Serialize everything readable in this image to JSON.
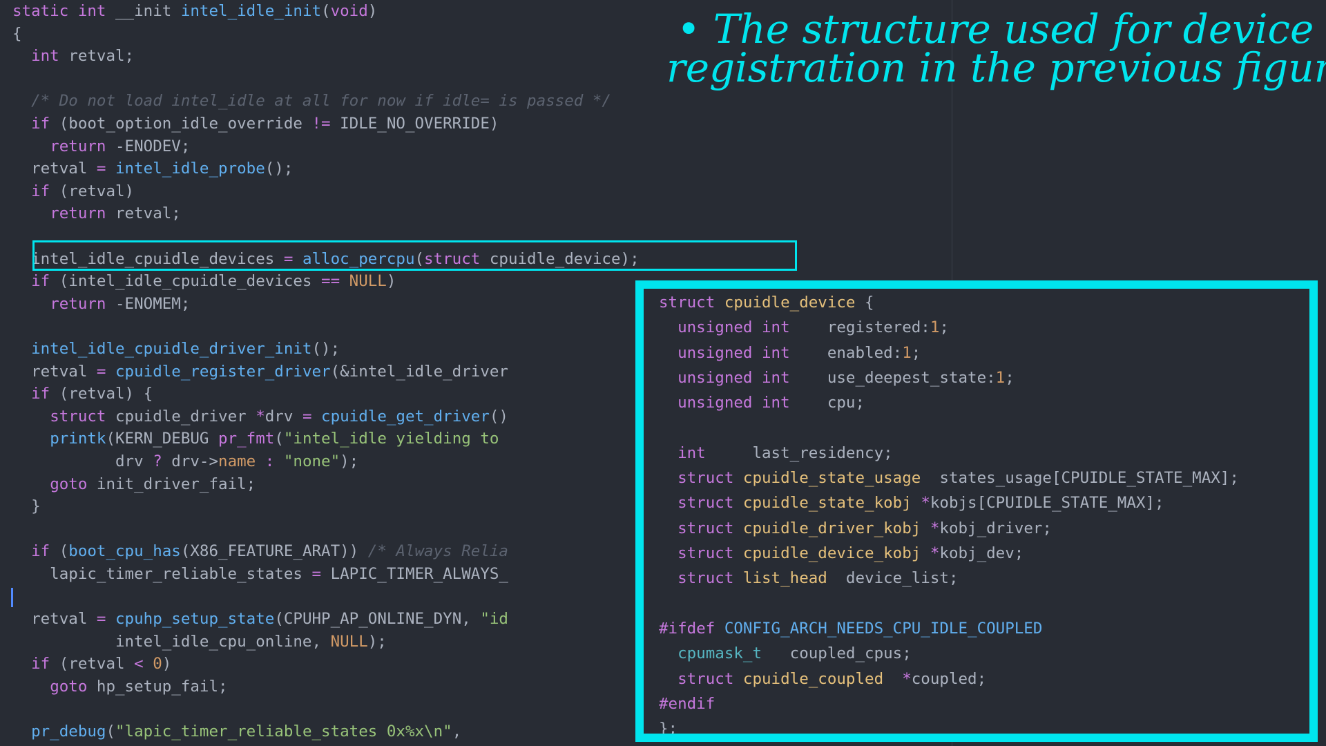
{
  "colors": {
    "background": "#282c34",
    "annotation": "#00e5ee",
    "keyword": "#c678dd",
    "function": "#61afef",
    "type": "#e5c07b",
    "number": "#d19a66",
    "string": "#98c379",
    "comment": "#5c6370"
  },
  "code_lines": [
    [
      {
        "t": "static int ",
        "c": "kw"
      },
      {
        "t": "__init ",
        "c": ""
      },
      {
        "t": "intel_idle_init",
        "c": "fn"
      },
      {
        "t": "(",
        "c": ""
      },
      {
        "t": "void",
        "c": "kw"
      },
      {
        "t": ")",
        "c": ""
      }
    ],
    [
      {
        "t": "{",
        "c": ""
      }
    ],
    [
      {
        "t": "  ",
        "c": ""
      },
      {
        "t": "int",
        "c": "kw"
      },
      {
        "t": " retval;",
        "c": ""
      }
    ],
    [],
    [
      {
        "t": "  /* Do not load intel_idle at all for now if idle= is passed */",
        "c": "cmt"
      }
    ],
    [
      {
        "t": "  ",
        "c": ""
      },
      {
        "t": "if",
        "c": "kw"
      },
      {
        "t": " (boot_option_idle_override ",
        "c": ""
      },
      {
        "t": "!=",
        "c": "op"
      },
      {
        "t": " IDLE_NO_OVERRIDE)",
        "c": ""
      }
    ],
    [
      {
        "t": "    ",
        "c": ""
      },
      {
        "t": "return",
        "c": "kw"
      },
      {
        "t": " -ENODEV;",
        "c": ""
      }
    ],
    [
      {
        "t": "  retval ",
        "c": ""
      },
      {
        "t": "=",
        "c": "op"
      },
      {
        "t": " ",
        "c": ""
      },
      {
        "t": "intel_idle_probe",
        "c": "fn"
      },
      {
        "t": "();",
        "c": ""
      }
    ],
    [
      {
        "t": "  ",
        "c": ""
      },
      {
        "t": "if",
        "c": "kw"
      },
      {
        "t": " (retval)",
        "c": ""
      }
    ],
    [
      {
        "t": "    ",
        "c": ""
      },
      {
        "t": "return",
        "c": "kw"
      },
      {
        "t": " retval;",
        "c": ""
      }
    ],
    [],
    [
      {
        "t": "  intel_idle_cpuidle_devices ",
        "c": ""
      },
      {
        "t": "=",
        "c": "op"
      },
      {
        "t": " ",
        "c": ""
      },
      {
        "t": "alloc_percpu",
        "c": "fn"
      },
      {
        "t": "(",
        "c": ""
      },
      {
        "t": "struct",
        "c": "kw"
      },
      {
        "t": " cpuidle_device);",
        "c": ""
      }
    ],
    [
      {
        "t": "  ",
        "c": ""
      },
      {
        "t": "if",
        "c": "kw"
      },
      {
        "t": " (intel_idle_cpuidle_devices ",
        "c": ""
      },
      {
        "t": "==",
        "c": "op"
      },
      {
        "t": " ",
        "c": ""
      },
      {
        "t": "NULL",
        "c": "num"
      },
      {
        "t": ")",
        "c": ""
      }
    ],
    [
      {
        "t": "    ",
        "c": ""
      },
      {
        "t": "return",
        "c": "kw"
      },
      {
        "t": " -ENOMEM;",
        "c": ""
      }
    ],
    [],
    [
      {
        "t": "  ",
        "c": ""
      },
      {
        "t": "intel_idle_cpuidle_driver_init",
        "c": "fn"
      },
      {
        "t": "();",
        "c": ""
      }
    ],
    [
      {
        "t": "  retval ",
        "c": ""
      },
      {
        "t": "=",
        "c": "op"
      },
      {
        "t": " ",
        "c": ""
      },
      {
        "t": "cpuidle_register_driver",
        "c": "fn"
      },
      {
        "t": "(&intel_idle_driver",
        "c": ""
      }
    ],
    [
      {
        "t": "  ",
        "c": ""
      },
      {
        "t": "if",
        "c": "kw"
      },
      {
        "t": " (retval) {",
        "c": ""
      }
    ],
    [
      {
        "t": "    ",
        "c": ""
      },
      {
        "t": "struct",
        "c": "kw"
      },
      {
        "t": " cpuidle_driver ",
        "c": ""
      },
      {
        "t": "*",
        "c": "op"
      },
      {
        "t": "drv ",
        "c": ""
      },
      {
        "t": "=",
        "c": "op"
      },
      {
        "t": " ",
        "c": ""
      },
      {
        "t": "cpuidle_get_driver",
        "c": "fn"
      },
      {
        "t": "()",
        "c": ""
      }
    ],
    [
      {
        "t": "    ",
        "c": ""
      },
      {
        "t": "printk",
        "c": "fn"
      },
      {
        "t": "(KERN_DEBUG ",
        "c": ""
      },
      {
        "t": "pr_fmt",
        "c": "kw"
      },
      {
        "t": "(",
        "c": ""
      },
      {
        "t": "\"intel_idle yielding to",
        "c": "str"
      }
    ],
    [
      {
        "t": "           drv ",
        "c": ""
      },
      {
        "t": "?",
        "c": "op"
      },
      {
        "t": " drv->",
        "c": ""
      },
      {
        "t": "name",
        "c": "num"
      },
      {
        "t": " ",
        "c": ""
      },
      {
        "t": ":",
        "c": "op"
      },
      {
        "t": " ",
        "c": ""
      },
      {
        "t": "\"none\"",
        "c": "str"
      },
      {
        "t": ");",
        "c": ""
      }
    ],
    [
      {
        "t": "    ",
        "c": ""
      },
      {
        "t": "goto",
        "c": "kw"
      },
      {
        "t": " init_driver_fail;",
        "c": ""
      }
    ],
    [
      {
        "t": "  }",
        "c": ""
      }
    ],
    [],
    [
      {
        "t": "  ",
        "c": ""
      },
      {
        "t": "if",
        "c": "kw"
      },
      {
        "t": " (",
        "c": ""
      },
      {
        "t": "boot_cpu_has",
        "c": "fn"
      },
      {
        "t": "(X86_FEATURE_ARAT)) ",
        "c": ""
      },
      {
        "t": "/* Always Relia",
        "c": "cmt"
      }
    ],
    [
      {
        "t": "    lapic_timer_reliable_states ",
        "c": ""
      },
      {
        "t": "=",
        "c": "op"
      },
      {
        "t": " LAPIC_TIMER_ALWAYS_",
        "c": ""
      }
    ],
    [],
    [
      {
        "t": "  retval ",
        "c": ""
      },
      {
        "t": "=",
        "c": "op"
      },
      {
        "t": " ",
        "c": ""
      },
      {
        "t": "cpuhp_setup_state",
        "c": "fn"
      },
      {
        "t": "(CPUHP_AP_ONLINE_DYN, ",
        "c": ""
      },
      {
        "t": "\"id",
        "c": "str"
      }
    ],
    [
      {
        "t": "           intel_idle_cpu_online, ",
        "c": ""
      },
      {
        "t": "NULL",
        "c": "num"
      },
      {
        "t": ");",
        "c": ""
      }
    ],
    [
      {
        "t": "  ",
        "c": ""
      },
      {
        "t": "if",
        "c": "kw"
      },
      {
        "t": " (retval ",
        "c": ""
      },
      {
        "t": "<",
        "c": "op"
      },
      {
        "t": " ",
        "c": ""
      },
      {
        "t": "0",
        "c": "num"
      },
      {
        "t": ")",
        "c": ""
      }
    ],
    [
      {
        "t": "    ",
        "c": ""
      },
      {
        "t": "goto",
        "c": "kw"
      },
      {
        "t": " hp_setup_fail;",
        "c": ""
      }
    ],
    [],
    [
      {
        "t": "  ",
        "c": ""
      },
      {
        "t": "pr_debug",
        "c": "fn"
      },
      {
        "t": "(",
        "c": ""
      },
      {
        "t": "\"lapic_timer_reliable_states 0x%x\\n\"",
        "c": "str"
      },
      {
        "t": ",",
        "c": ""
      }
    ]
  ],
  "struct_lines": [
    [
      {
        "t": "struct ",
        "c": "kw"
      },
      {
        "t": "cpuidle_device",
        "c": "ty"
      },
      {
        "t": " {",
        "c": ""
      }
    ],
    [
      {
        "t": "  ",
        "c": ""
      },
      {
        "t": "unsigned int",
        "c": "kw"
      },
      {
        "t": "    registered:",
        "c": ""
      },
      {
        "t": "1",
        "c": "num"
      },
      {
        "t": ";",
        "c": ""
      }
    ],
    [
      {
        "t": "  ",
        "c": ""
      },
      {
        "t": "unsigned int",
        "c": "kw"
      },
      {
        "t": "    enabled:",
        "c": ""
      },
      {
        "t": "1",
        "c": "num"
      },
      {
        "t": ";",
        "c": ""
      }
    ],
    [
      {
        "t": "  ",
        "c": ""
      },
      {
        "t": "unsigned int",
        "c": "kw"
      },
      {
        "t": "    use_deepest_state:",
        "c": ""
      },
      {
        "t": "1",
        "c": "num"
      },
      {
        "t": ";",
        "c": ""
      }
    ],
    [
      {
        "t": "  ",
        "c": ""
      },
      {
        "t": "unsigned int",
        "c": "kw"
      },
      {
        "t": "    cpu;",
        "c": ""
      }
    ],
    [],
    [
      {
        "t": "  ",
        "c": ""
      },
      {
        "t": "int",
        "c": "kw"
      },
      {
        "t": "     last_residency;",
        "c": ""
      }
    ],
    [
      {
        "t": "  ",
        "c": ""
      },
      {
        "t": "struct",
        "c": "kw"
      },
      {
        "t": " ",
        "c": ""
      },
      {
        "t": "cpuidle_state_usage",
        "c": "ty"
      },
      {
        "t": "  states_usage[CPUIDLE_STATE_MAX];",
        "c": ""
      }
    ],
    [
      {
        "t": "  ",
        "c": ""
      },
      {
        "t": "struct",
        "c": "kw"
      },
      {
        "t": " ",
        "c": ""
      },
      {
        "t": "cpuidle_state_kobj",
        "c": "ty"
      },
      {
        "t": " ",
        "c": ""
      },
      {
        "t": "*",
        "c": "op"
      },
      {
        "t": "kobjs[CPUIDLE_STATE_MAX];",
        "c": ""
      }
    ],
    [
      {
        "t": "  ",
        "c": ""
      },
      {
        "t": "struct",
        "c": "kw"
      },
      {
        "t": " ",
        "c": ""
      },
      {
        "t": "cpuidle_driver_kobj",
        "c": "ty"
      },
      {
        "t": " ",
        "c": ""
      },
      {
        "t": "*",
        "c": "op"
      },
      {
        "t": "kobj_driver;",
        "c": ""
      }
    ],
    [
      {
        "t": "  ",
        "c": ""
      },
      {
        "t": "struct",
        "c": "kw"
      },
      {
        "t": " ",
        "c": ""
      },
      {
        "t": "cpuidle_device_kobj",
        "c": "ty"
      },
      {
        "t": " ",
        "c": ""
      },
      {
        "t": "*",
        "c": "op"
      },
      {
        "t": "kobj_dev;",
        "c": ""
      }
    ],
    [
      {
        "t": "  ",
        "c": ""
      },
      {
        "t": "struct",
        "c": "kw"
      },
      {
        "t": " ",
        "c": ""
      },
      {
        "t": "list_head",
        "c": "ty"
      },
      {
        "t": "  device_list;",
        "c": ""
      }
    ],
    [],
    [
      {
        "t": "#ifdef",
        "c": "kw"
      },
      {
        "t": " ",
        "c": ""
      },
      {
        "t": "CONFIG_ARCH_NEEDS_CPU_IDLE_COUPLED",
        "c": "fn"
      }
    ],
    [
      {
        "t": "  ",
        "c": ""
      },
      {
        "t": "cpumask_t",
        "c": "cy"
      },
      {
        "t": "   coupled_cpus;",
        "c": ""
      }
    ],
    [
      {
        "t": "  ",
        "c": ""
      },
      {
        "t": "struct",
        "c": "kw"
      },
      {
        "t": " ",
        "c": ""
      },
      {
        "t": "cpuidle_coupled",
        "c": "ty"
      },
      {
        "t": "  ",
        "c": ""
      },
      {
        "t": "*",
        "c": "op"
      },
      {
        "t": "coupled;",
        "c": ""
      }
    ],
    [
      {
        "t": "#endif",
        "c": "kw"
      }
    ],
    [
      {
        "t": "};",
        "c": ""
      }
    ]
  ],
  "annotation": {
    "line1": "• The structure used for device (CPU)",
    "line2": "registration in the previous figure."
  }
}
